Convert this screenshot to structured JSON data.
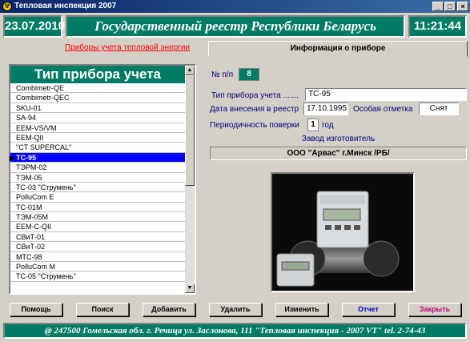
{
  "window": {
    "title": "Тепловая инспекция 2007"
  },
  "header": {
    "date": "23.07.2010",
    "title": "Государственный реестр Республики Беларусь",
    "time": "11:21:44"
  },
  "tabs": {
    "left": "Приборы учета тепловой энергии",
    "right": "Информация о приборе"
  },
  "list": {
    "header": "Тип прибора учета",
    "items": [
      "Combimetr-QE",
      "Combimetr-QEC",
      "SKU-01",
      "SA-94",
      "EEM-VS/VM",
      "EEM-QII",
      "\"CT SUPERCAL\"",
      "TC-95",
      "ТЭРМ-02",
      "ТЭМ-05",
      "ТС-03 \"Струмень\"",
      "PolluCom E",
      "TC-01M",
      "ТЭМ-05М",
      "EEM-C-QII",
      "СВиТ-01",
      "СВиТ-02",
      "MTC-98",
      "PolluCom M",
      "ТС-05 \"Струмень\""
    ],
    "selected_index": 7
  },
  "info": {
    "num_label": "№ п/п",
    "num_value": "8",
    "type_label": "Тип прибора учета .......",
    "type_value": "TC-95",
    "date_label": "Дата внесения в реестр",
    "date_value": "17.10.1995",
    "mark_label": "Особая отметка",
    "mark_value": "Снят",
    "period_label": "Периодичность поверки",
    "period_value": "1",
    "period_unit": "год",
    "factory_label": "Завод  изготовитель",
    "factory_value": "ООО \"Арвас\" г.Минск /РБ/"
  },
  "buttons": {
    "help": "Помощь",
    "search": "Поиск",
    "add": "Добавить",
    "delete": "Удалить",
    "edit": "Изменить",
    "report": "Отчет",
    "close": "Закрыть"
  },
  "colors": {
    "accent": "#007b65",
    "selection": "#0000ff",
    "report_text": "#0000c0",
    "close_text": "#c00080"
  },
  "footer": {
    "text": "@ 247500 Гомельская обл.  г. Речица  ул. Заслонова, 111  \"Тепловая инспекция - 2007 VT\"  tel. 2-74-43"
  }
}
